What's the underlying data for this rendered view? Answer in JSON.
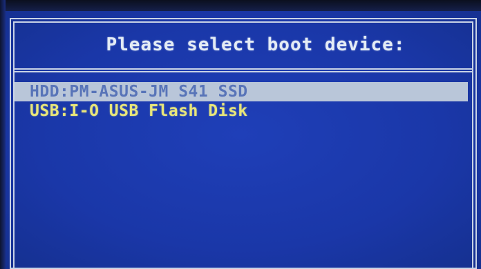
{
  "boot_menu": {
    "title": "Please select boot device:",
    "devices": [
      {
        "label": "HDD:PM-ASUS-JM S41 SSD",
        "selected": true
      },
      {
        "label": "USB:I-O USB Flash Disk",
        "selected": false
      }
    ]
  },
  "colors": {
    "background": "#1a37a8",
    "border": "#c9d3e6",
    "title_text": "#e4ecf5",
    "selected_bg": "#b9c6d9",
    "selected_text": "#5874b8",
    "item_text": "#e8e67a"
  }
}
